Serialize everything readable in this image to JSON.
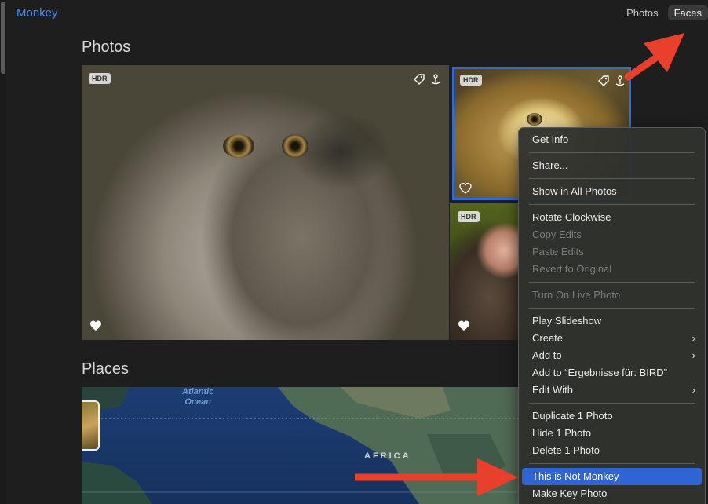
{
  "header": {
    "album_title": "Monkey",
    "view_tabs": [
      {
        "label": "Photos",
        "active": false
      },
      {
        "label": "Faces",
        "active": true
      }
    ]
  },
  "sections": {
    "photos_heading": "Photos",
    "places_heading": "Places"
  },
  "photos": [
    {
      "badge": "HDR",
      "favorite_icon": "heart-icon",
      "keyword_icon": "tag-icon",
      "pin_icon": "pin-icon"
    },
    {
      "badge": "HDR",
      "favorite_icon": "heart-icon",
      "keyword_icon": "tag-icon",
      "pin_icon": "pin-icon",
      "selected": true
    },
    {
      "badge": "HDR",
      "favorite_icon": "heart-icon"
    }
  ],
  "map": {
    "ocean_label": "Atlantic\nOcean",
    "continent_label": "AFRICA"
  },
  "context_menu": {
    "groups": [
      [
        {
          "label": "Get Info"
        }
      ],
      [
        {
          "label": "Share..."
        }
      ],
      [
        {
          "label": "Show in All Photos"
        }
      ],
      [
        {
          "label": "Rotate Clockwise"
        },
        {
          "label": "Copy Edits",
          "disabled": true
        },
        {
          "label": "Paste Edits",
          "disabled": true
        },
        {
          "label": "Revert to Original",
          "disabled": true
        }
      ],
      [
        {
          "label": "Turn On Live Photo",
          "disabled": true
        }
      ],
      [
        {
          "label": "Play Slideshow"
        },
        {
          "label": "Create",
          "submenu": true
        },
        {
          "label": "Add to",
          "submenu": true
        },
        {
          "label": "Add to “Ergebnisse für: BIRD”"
        },
        {
          "label": "Edit With",
          "submenu": true
        }
      ],
      [
        {
          "label": "Duplicate 1 Photo"
        },
        {
          "label": "Hide 1 Photo"
        },
        {
          "label": "Delete 1 Photo"
        }
      ],
      [
        {
          "label": "This is Not Monkey",
          "highlighted": true
        },
        {
          "label": "Make Key Photo"
        }
      ]
    ]
  },
  "colors": {
    "accent_blue": "#3d8ef5",
    "selection_blue": "#2f64d6",
    "annotation_red": "#e8402a"
  }
}
